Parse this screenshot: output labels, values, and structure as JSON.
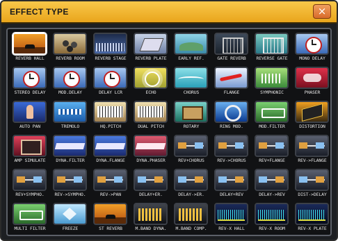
{
  "window": {
    "title": "EFFECT TYPE",
    "close_label": "×",
    "accent_color": "#f0b838"
  },
  "selected_index": 0,
  "effects": [
    {
      "label": "REVERB HALL",
      "icon": "stage-icon"
    },
    {
      "label": "REVERB ROOM",
      "icon": "room-icon"
    },
    {
      "label": "REVERB STAGE",
      "icon": "concert-icon"
    },
    {
      "label": "REVERB PLATE",
      "icon": "plate-icon"
    },
    {
      "label": "EARLY REF.",
      "icon": "early-icon"
    },
    {
      "label": "GATE REVERB",
      "icon": "gate-icon"
    },
    {
      "label": "REVERSE GATE",
      "icon": "revgate-icon"
    },
    {
      "label": "MONO DELAY",
      "icon": "clock-icon"
    },
    {
      "label": "STEREO DELAY",
      "icon": "clock-icon"
    },
    {
      "label": "MOD.DELAY",
      "icon": "clock-icon"
    },
    {
      "label": "DELAY LCR",
      "icon": "clock-icon"
    },
    {
      "label": "ECHO",
      "icon": "echo-icon"
    },
    {
      "label": "CHORUS",
      "icon": "chorus-icon"
    },
    {
      "label": "FLANGE",
      "icon": "flange-icon"
    },
    {
      "label": "SYMPHONIC",
      "icon": "symph-icon"
    },
    {
      "label": "PHASER",
      "icon": "phaser-icon"
    },
    {
      "label": "AUTO PAN",
      "icon": "pan-icon"
    },
    {
      "label": "TREMOLO",
      "icon": "trem-icon"
    },
    {
      "label": "HQ.PITCH",
      "icon": "pitch-icon"
    },
    {
      "label": "DUAL PITCH",
      "icon": "pitch-icon"
    },
    {
      "label": "ROTARY",
      "icon": "rotary-icon"
    },
    {
      "label": "RING MOD.",
      "icon": "ring-icon"
    },
    {
      "label": "MOD.FILTER",
      "icon": "modf-icon"
    },
    {
      "label": "DISTORTION",
      "icon": "dist-icon"
    },
    {
      "label": "AMP SIMULATE",
      "icon": "amp-icon"
    },
    {
      "label": "DYNA.FILTER",
      "icon": "dyn-icon"
    },
    {
      "label": "DYNA.FLANGE",
      "icon": "dyn-icon"
    },
    {
      "label": "DYNA.PHASER",
      "icon": "dynp-icon"
    },
    {
      "label": "REV+CHORUS",
      "icon": "multi-icon"
    },
    {
      "label": "REV->CHORUS",
      "icon": "multi-icon"
    },
    {
      "label": "REV+FLANGE",
      "icon": "multi-icon"
    },
    {
      "label": "REV->FLANGE",
      "icon": "multi-icon"
    },
    {
      "label": "REV+SYMPHO.",
      "icon": "multi-icon"
    },
    {
      "label": "REV->SYMPHO.",
      "icon": "multi-icon"
    },
    {
      "label": "REV->PAN",
      "icon": "multi-icon"
    },
    {
      "label": "DELAY+ER.",
      "icon": "multi2-icon"
    },
    {
      "label": "DELAY->ER.",
      "icon": "multi2-icon"
    },
    {
      "label": "DELAY+REV",
      "icon": "multi2-icon"
    },
    {
      "label": "DELAY->REV",
      "icon": "multi2-icon"
    },
    {
      "label": "DIST->DELAY",
      "icon": "multi2-icon"
    },
    {
      "label": "MULTI FILTER",
      "icon": "modf-icon"
    },
    {
      "label": "FREEZE",
      "icon": "freeze-icon"
    },
    {
      "label": "ST REVERB",
      "icon": "stage-icon"
    },
    {
      "label": "M.BAND DYNA.",
      "icon": "mband-icon"
    },
    {
      "label": "M.BAND COMP.",
      "icon": "mband-icon"
    },
    {
      "label": "REV-X HALL",
      "icon": "revx-icon"
    },
    {
      "label": "REV-X ROOM",
      "icon": "revx-icon"
    },
    {
      "label": "REV-X PLATE",
      "icon": "revx-icon"
    }
  ]
}
